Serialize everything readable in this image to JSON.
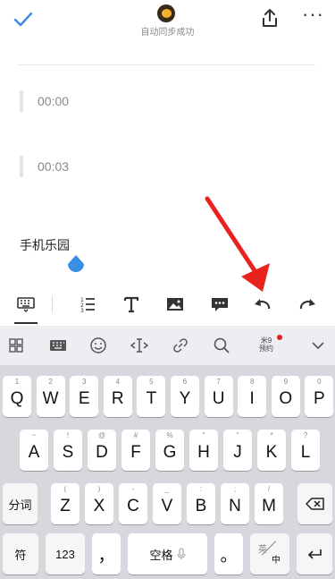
{
  "header": {
    "status": "自动同步成功"
  },
  "notes": {
    "audio_items": [
      "00:00",
      "00:03"
    ],
    "text": "手机乐园"
  },
  "toolbar": {
    "items": [
      "keyboard-icon",
      "list-icon",
      "text-format-icon",
      "image-icon",
      "comment-icon",
      "undo-icon",
      "redo-icon"
    ]
  },
  "keyboard": {
    "mi_label_line1": "米9",
    "mi_label_line2": "预约",
    "row1": [
      {
        "k": "Q",
        "s": "1"
      },
      {
        "k": "W",
        "s": "2"
      },
      {
        "k": "E",
        "s": "3"
      },
      {
        "k": "R",
        "s": "4"
      },
      {
        "k": "T",
        "s": "5"
      },
      {
        "k": "Y",
        "s": "6"
      },
      {
        "k": "U",
        "s": "7"
      },
      {
        "k": "I",
        "s": "8"
      },
      {
        "k": "O",
        "s": "9"
      },
      {
        "k": "P",
        "s": "0"
      }
    ],
    "row2": [
      {
        "k": "A",
        "s": "~"
      },
      {
        "k": "S",
        "s": "!"
      },
      {
        "k": "D",
        "s": "@"
      },
      {
        "k": "F",
        "s": "#"
      },
      {
        "k": "G",
        "s": "%"
      },
      {
        "k": "H",
        "s": "\""
      },
      {
        "k": "J",
        "s": "\""
      },
      {
        "k": "K",
        "s": "*"
      },
      {
        "k": "L",
        "s": "?"
      }
    ],
    "row3": [
      {
        "k": "Z",
        "s": "("
      },
      {
        "k": "X",
        "s": ")"
      },
      {
        "k": "C",
        "s": "-"
      },
      {
        "k": "V",
        "s": "_"
      },
      {
        "k": "B",
        "s": ":"
      },
      {
        "k": "N",
        "s": ";"
      },
      {
        "k": "M",
        "s": "/"
      }
    ],
    "fenci": "分词",
    "fu": "符",
    "num": "123",
    "comma": "，",
    "space": "空格",
    "period": "。",
    "lang_top": "英",
    "lang_bottom": "中"
  }
}
